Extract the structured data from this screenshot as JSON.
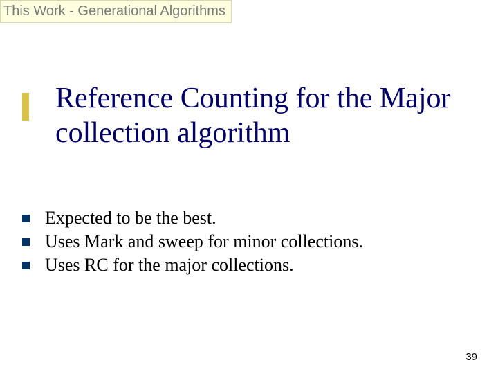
{
  "breadcrumb": "This Work - Generational Algorithms",
  "title": "Reference Counting for the Major collection algorithm",
  "bullets": [
    "Expected to be the best.",
    "Uses Mark and sweep for minor collections.",
    "Uses RC for the major collections."
  ],
  "page_number": "39"
}
